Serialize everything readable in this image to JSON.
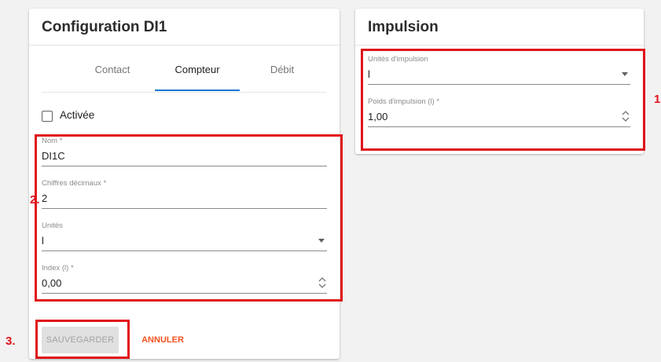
{
  "left_card": {
    "title": "Configuration DI1",
    "tabs": [
      {
        "label": "Contact"
      },
      {
        "label": "Compteur"
      },
      {
        "label": "Débit"
      }
    ],
    "active_tab": "Compteur",
    "checkbox": {
      "label": "Activée",
      "checked": false
    },
    "fields": {
      "nom": {
        "label": "Nom *",
        "value": "DI1C"
      },
      "chiffres": {
        "label": "Chiffres décimaux *",
        "value": "2"
      },
      "unites": {
        "label": "Unités",
        "value": "l"
      },
      "index": {
        "label": "Index (l) *",
        "value": "0,00"
      }
    },
    "save_label": "SAUVEGARDER",
    "cancel_label": "ANNULER"
  },
  "right_card": {
    "title": "Impulsion",
    "fields": {
      "unites_impulsion": {
        "label": "Unités d'impulsion",
        "value": "l"
      },
      "poids_impulsion": {
        "label": "Poids d'impulsion (l) *",
        "value": "1,00"
      }
    }
  },
  "annotations": {
    "step1": "1",
    "step2": "2.",
    "step3": "3."
  },
  "colors": {
    "highlight": "#e0141a",
    "accent_tab": "#1976d2",
    "cancel": "#f4511e"
  }
}
